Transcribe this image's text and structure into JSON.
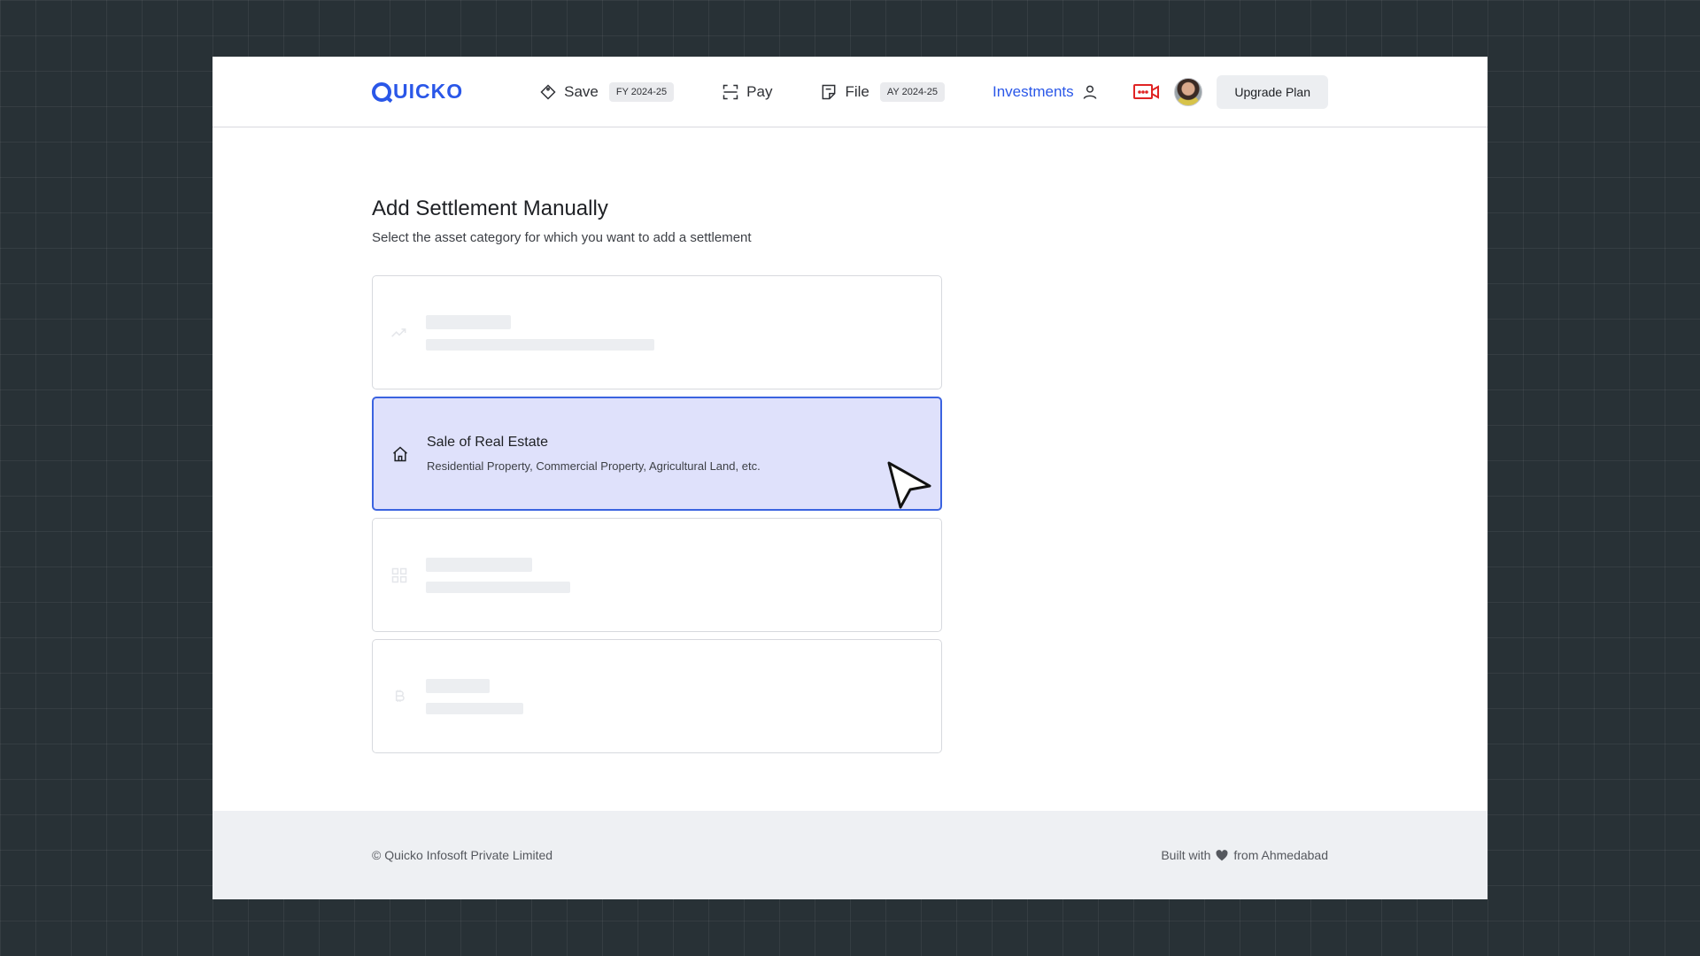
{
  "header": {
    "logo_text": "UICKO",
    "nav": [
      {
        "label": "Save",
        "chip": "FY 2024-25",
        "icon": "tag-icon"
      },
      {
        "label": "Pay",
        "icon": "scan-icon"
      },
      {
        "label": "File",
        "chip": "AY 2024-25",
        "icon": "file-note-icon"
      }
    ],
    "investments_label": "Investments",
    "upgrade_label": "Upgrade Plan",
    "accent": "#2a57e8",
    "video_icon_color": "#e02424"
  },
  "main": {
    "title": "Add Settlement Manually",
    "subtitle": "Select the asset category for which you want to add a settlement",
    "cards": [
      {
        "state": "loading",
        "icon": "trend-icon"
      },
      {
        "state": "selected",
        "icon": "home-icon",
        "title": "Sale of Real Estate",
        "description": "Residential Property, Commercial Property, Agricultural Land, etc."
      },
      {
        "state": "loading",
        "icon": "grid-icon"
      },
      {
        "state": "loading",
        "icon": "bitcoin-icon"
      }
    ]
  },
  "footer": {
    "copyright": "© Quicko Infosoft Private Limited",
    "built_with": "Built with",
    "from": "from Ahmedabad"
  }
}
